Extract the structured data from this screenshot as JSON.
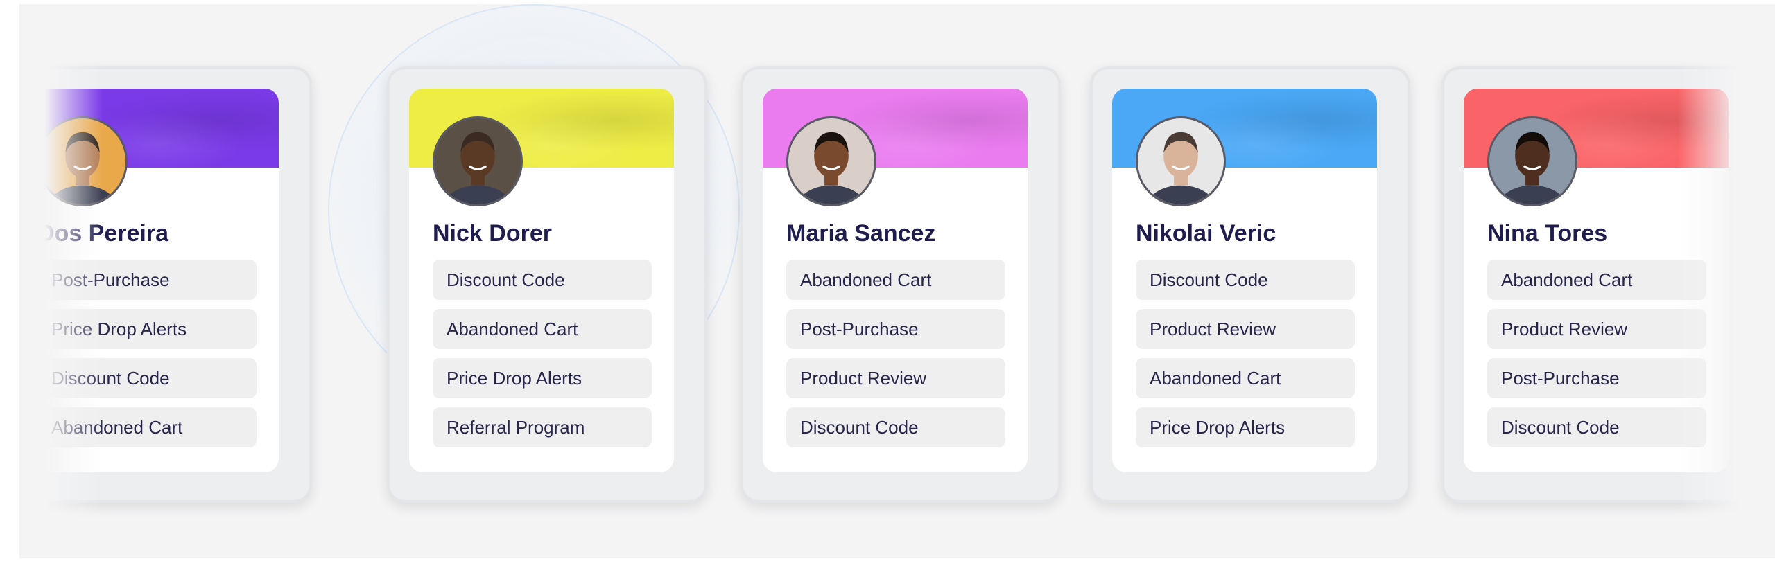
{
  "cards": [
    {
      "name": "Dos Pereira",
      "banner_color": "#7a3ae8",
      "avatar_bg": "#e9a84a",
      "skin": "#b07a52",
      "hair": "#2a1d14",
      "tags": [
        "Post-Purchase",
        "Price Drop Alerts",
        "Discount Code",
        "Abandoned Cart"
      ]
    },
    {
      "name": "Nick Dorer",
      "banner_color": "#eded46",
      "avatar_bg": "#5b5045",
      "skin": "#5a3a25",
      "hair": "#3a2a22",
      "tags": [
        "Discount Code",
        "Abandoned Cart",
        "Price Drop Alerts",
        "Referral Program"
      ]
    },
    {
      "name": "Maria Sancez",
      "banner_color": "#ea7cf0",
      "avatar_bg": "#d9cfc8",
      "skin": "#7a4a2e",
      "hair": "#1a120c",
      "tags": [
        "Abandoned Cart",
        "Post-Purchase",
        "Product Review",
        "Discount Code"
      ]
    },
    {
      "name": "Nikolai Veric",
      "banner_color": "#4aa8f6",
      "avatar_bg": "#e7e7e7",
      "skin": "#d9b39a",
      "hair": "#4a3c34",
      "tags": [
        "Discount Code",
        "Product Review",
        "Abandoned Cart",
        "Price Drop Alerts"
      ]
    },
    {
      "name": "Nina Tores",
      "banner_color": "#fa6468",
      "avatar_bg": "#8a98a8",
      "skin": "#4e2e1e",
      "hair": "#140c08",
      "tags": [
        "Abandoned Cart",
        "Product Review",
        "Post-Purchase",
        "Discount Code"
      ]
    }
  ]
}
